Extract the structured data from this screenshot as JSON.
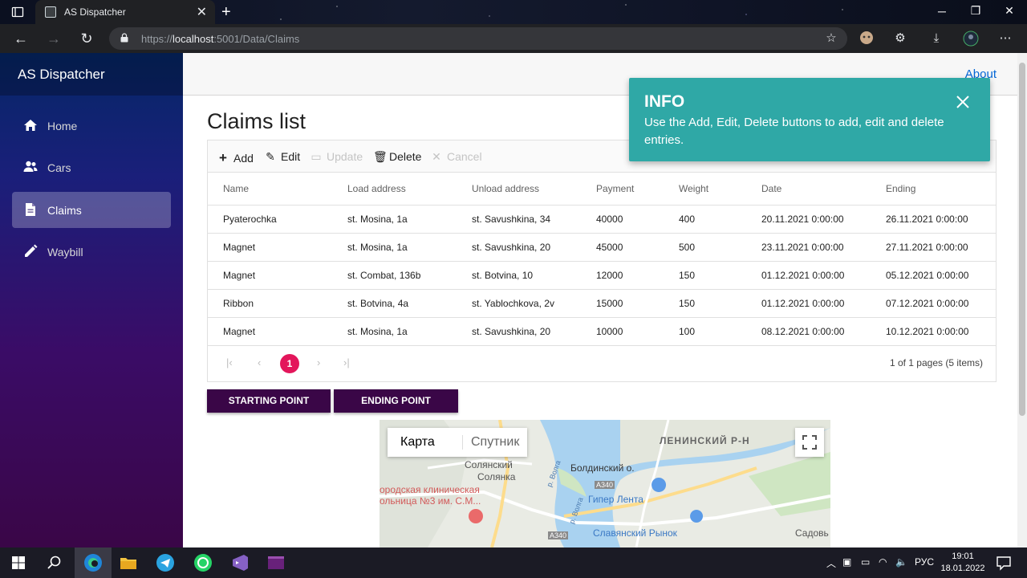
{
  "browser": {
    "tab_title": "AS Dispatcher",
    "url_prefix": "https://",
    "url_host": "localhost",
    "url_rest": ":5001/Data/Claims"
  },
  "sidebar": {
    "brand": "AS Dispatcher",
    "items": [
      {
        "label": "Home",
        "icon": "home-icon"
      },
      {
        "label": "Cars",
        "icon": "users-icon"
      },
      {
        "label": "Claims",
        "icon": "document-icon",
        "active": true
      },
      {
        "label": "Waybill",
        "icon": "pencil-icon"
      }
    ]
  },
  "header": {
    "about": "About"
  },
  "page": {
    "title": "Claims list"
  },
  "toolbar": {
    "add": "Add",
    "edit": "Edit",
    "update": "Update",
    "delete": "Delete",
    "cancel": "Cancel"
  },
  "table": {
    "columns": [
      "Name",
      "Load address",
      "Unload address",
      "Payment",
      "Weight",
      "Date",
      "Ending"
    ],
    "rows": [
      [
        "Pyaterochka",
        "st. Mosina, 1a",
        "st. Savushkina, 34",
        "40000",
        "400",
        "20.11.2021 0:00:00",
        "26.11.2021 0:00:00"
      ],
      [
        "Magnet",
        "st. Mosina, 1a",
        "st. Savushkina, 20",
        "45000",
        "500",
        "23.11.2021 0:00:00",
        "27.11.2021 0:00:00"
      ],
      [
        "Magnet",
        "st. Combat, 136b",
        "st. Botvina, 10",
        "12000",
        "150",
        "01.12.2021 0:00:00",
        "05.12.2021 0:00:00"
      ],
      [
        "Ribbon",
        "st. Botvina, 4a",
        "st. Yablochkova, 2v",
        "15000",
        "150",
        "01.12.2021 0:00:00",
        "07.12.2021 0:00:00"
      ],
      [
        "Magnet",
        "st. Mosina, 1a",
        "st. Savushkina, 20",
        "10000",
        "100",
        "08.12.2021 0:00:00",
        "10.12.2021 0:00:00"
      ]
    ]
  },
  "pager": {
    "current": "1",
    "info": "1 of 1 pages (5 items)"
  },
  "buttons": {
    "start": "STARTING POINT",
    "end": "ENDING POINT"
  },
  "map": {
    "type_map": "Карта",
    "type_sat": "Спутник",
    "labels": {
      "leninsky": "ЛЕНИНСКИЙ Р-Н",
      "solyansky1": "Солянский",
      "solyansky2": "Солянка",
      "boldinsky": "Болдинский о.",
      "hospital1": "ородская клиническая",
      "hospital2": "ольница №3 им. С.М...",
      "volga1": "р. Волга",
      "volga2": "р. Волга",
      "a340a": "А340",
      "a340b": "А340",
      "lenta": "Гипер Лента",
      "rynok": "Славянский Рынок",
      "sadov": "Садовь"
    }
  },
  "toast": {
    "title": "INFO",
    "message": "Use the Add, Edit, Delete buttons to add, edit and delete entries."
  },
  "taskbar": {
    "lang": "РУС",
    "time": "19:01",
    "date": "18.01.2022"
  },
  "colors": {
    "accent_pink": "#e3165b",
    "toast": "#2fa8a6",
    "button": "#3a0647",
    "link": "#0366d6"
  }
}
